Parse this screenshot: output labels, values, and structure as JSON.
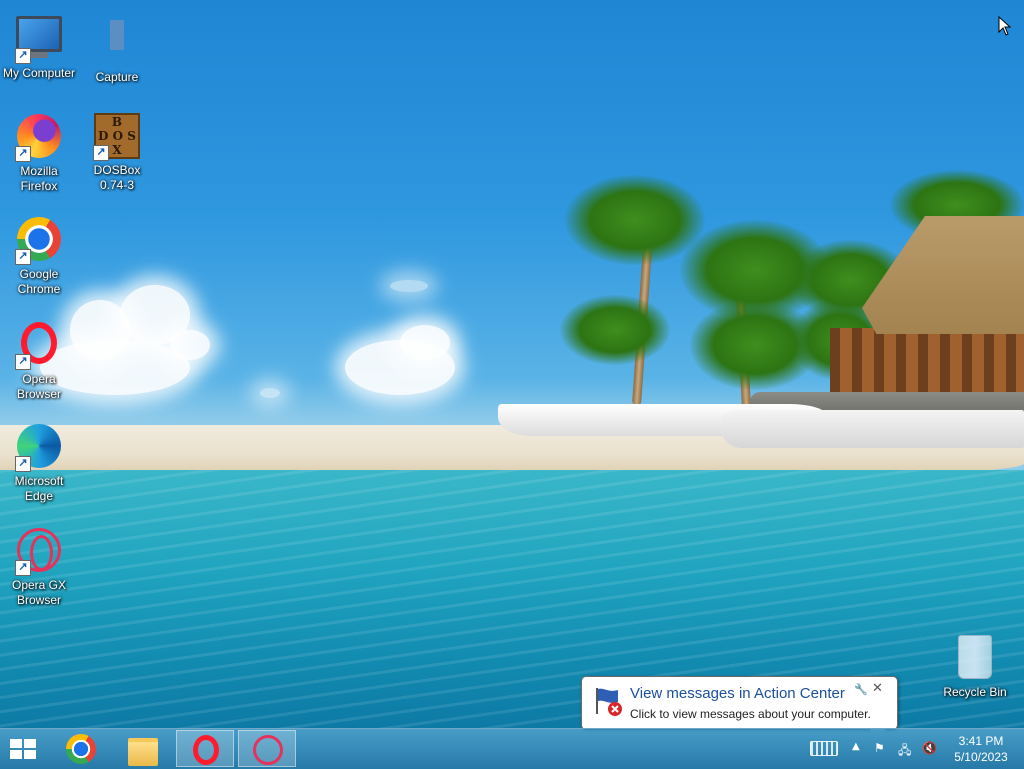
{
  "desktop": {
    "icons": [
      {
        "label": "My Computer",
        "icon": "computer-icon",
        "shortcut": true
      },
      {
        "label": "Capture",
        "icon": "folder-icon",
        "shortcut": false
      },
      {
        "label": "Mozilla Firefox",
        "icon": "firefox-icon",
        "shortcut": true
      },
      {
        "label": "DOSBox 0.74-3",
        "icon": "dosbox-icon",
        "shortcut": true
      },
      {
        "label": "Google Chrome",
        "icon": "chrome-icon",
        "shortcut": true
      },
      {
        "label": "Opera Browser",
        "icon": "opera-icon",
        "shortcut": true
      },
      {
        "label": "Microsoft Edge",
        "icon": "edge-icon",
        "shortcut": true
      },
      {
        "label": "Opera GX Browser",
        "icon": "opera-gx-icon",
        "shortcut": true
      },
      {
        "label": "Recycle Bin",
        "icon": "recycle-bin-icon",
        "shortcut": false
      }
    ],
    "dosbox_letters": [
      "B",
      "D",
      "O",
      "S",
      "X"
    ]
  },
  "balloon": {
    "title": "View messages in Action Center",
    "text": "Click to view messages about your computer.",
    "close": "✕",
    "settings": "🔧"
  },
  "taskbar": {
    "start": "start-icon",
    "pinned": [
      {
        "name": "Google Chrome",
        "icon": "chrome-icon",
        "active": false
      },
      {
        "name": "File Explorer",
        "icon": "folder-icon",
        "active": false
      },
      {
        "name": "Opera Browser",
        "icon": "opera-icon",
        "active": true
      },
      {
        "name": "Opera GX Browser",
        "icon": "opera-gx-icon",
        "active": true
      }
    ],
    "tray": {
      "show_hidden": "▲",
      "action_center": "⚑",
      "network": "🖧",
      "volume": "🔇"
    },
    "clock": {
      "time": "3:41 PM",
      "date": "5/10/2023"
    }
  },
  "colors": {
    "taskbar": "#1b7fb5",
    "balloon_title": "#1b4f9c",
    "opera_red": "#ff1b2d",
    "opera_gx_pink": "#e6315b"
  }
}
